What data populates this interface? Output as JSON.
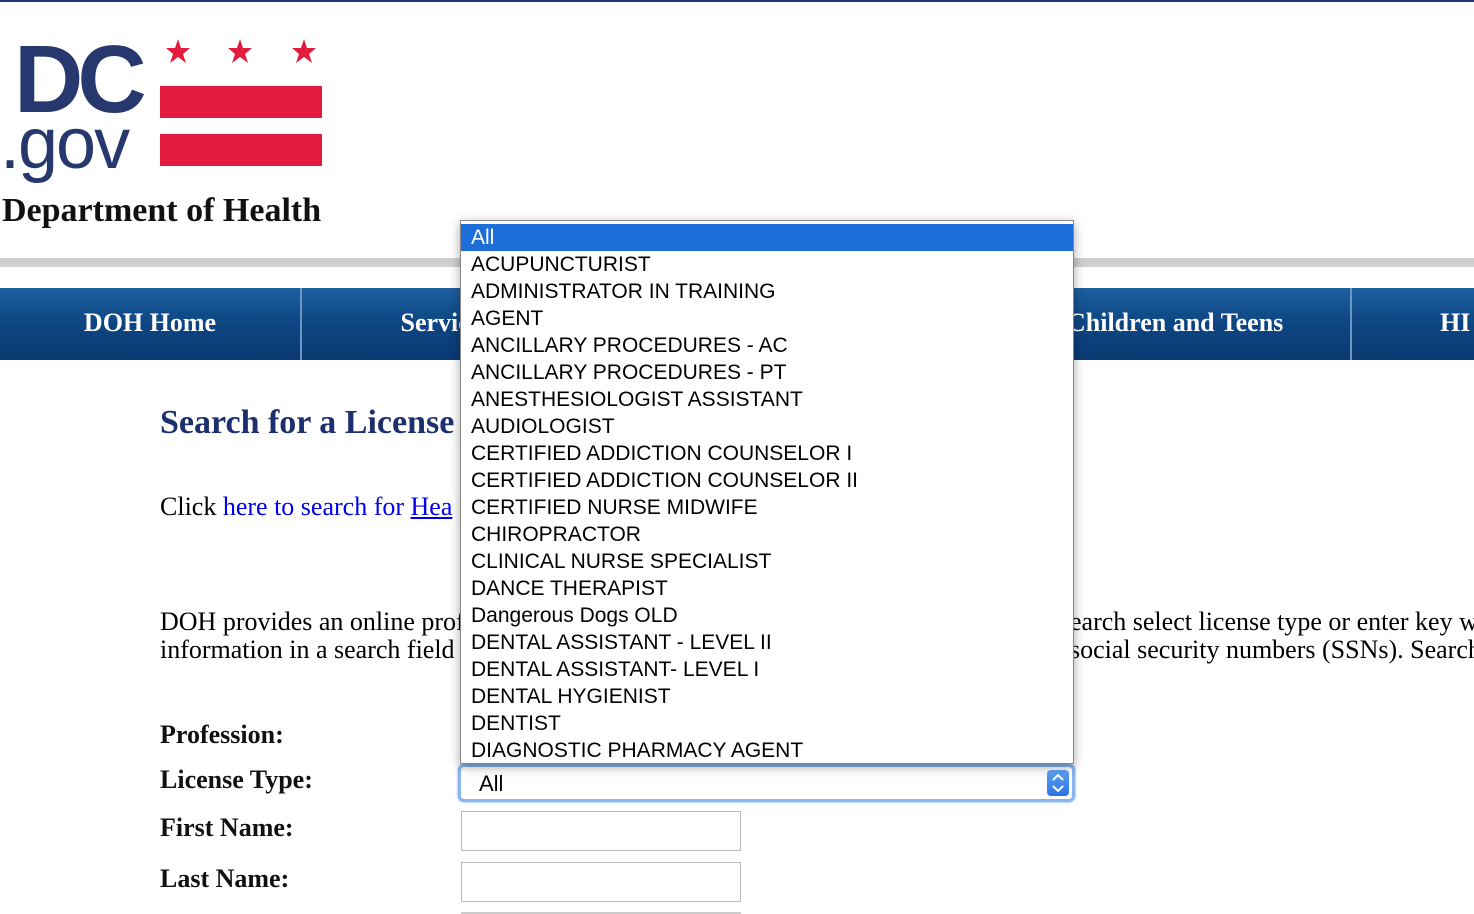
{
  "header": {
    "logo_dc": "DC",
    "logo_gov": ".gov",
    "department": "Department of Health"
  },
  "nav": {
    "items": [
      {
        "label": "DOH Home"
      },
      {
        "label": "Services"
      },
      {
        "label": ""
      },
      {
        "label": "Children and Teens"
      },
      {
        "label": "HI"
      }
    ]
  },
  "main": {
    "title": "Search for a License",
    "click_prefix": "Click ",
    "click_link": "here to search for ",
    "click_link_ul": "Hea",
    "para_line1_left": "DOH provides an online prof",
    "para_line1_right": "earch select license type or enter key w",
    "para_line2_left": "information in a search field",
    "para_line2_right": "social security numbers (SSNs). Search"
  },
  "form": {
    "profession_label": "Profession:",
    "license_type_label": "License Type:",
    "license_type_value": "All",
    "first_name_label": "First Name:",
    "last_name_label": "Last Name:"
  },
  "dropdown": {
    "selected": "All",
    "options": [
      "All",
      "ACUPUNCTURIST",
      "ADMINISTRATOR IN TRAINING",
      "AGENT",
      "ANCILLARY PROCEDURES - AC",
      "ANCILLARY PROCEDURES - PT",
      "ANESTHESIOLOGIST ASSISTANT",
      "AUDIOLOGIST",
      "CERTIFIED ADDICTION COUNSELOR I",
      "CERTIFIED ADDICTION COUNSELOR II",
      "CERTIFIED NURSE MIDWIFE",
      "CHIROPRACTOR",
      "CLINICAL NURSE SPECIALIST",
      "DANCE THERAPIST",
      "Dangerous Dogs OLD",
      "DENTAL ASSISTANT - LEVEL II",
      "DENTAL ASSISTANT- LEVEL I",
      "DENTAL HYGIENIST",
      "DENTIST",
      "DIAGNOSTIC PHARMACY AGENT"
    ]
  },
  "colors": {
    "brand_navy": "#27386f",
    "flag_red": "#e31c3d",
    "nav_blue": "#0d4582",
    "link_blue": "#0000ee",
    "selection_blue": "#1e6ed9"
  }
}
